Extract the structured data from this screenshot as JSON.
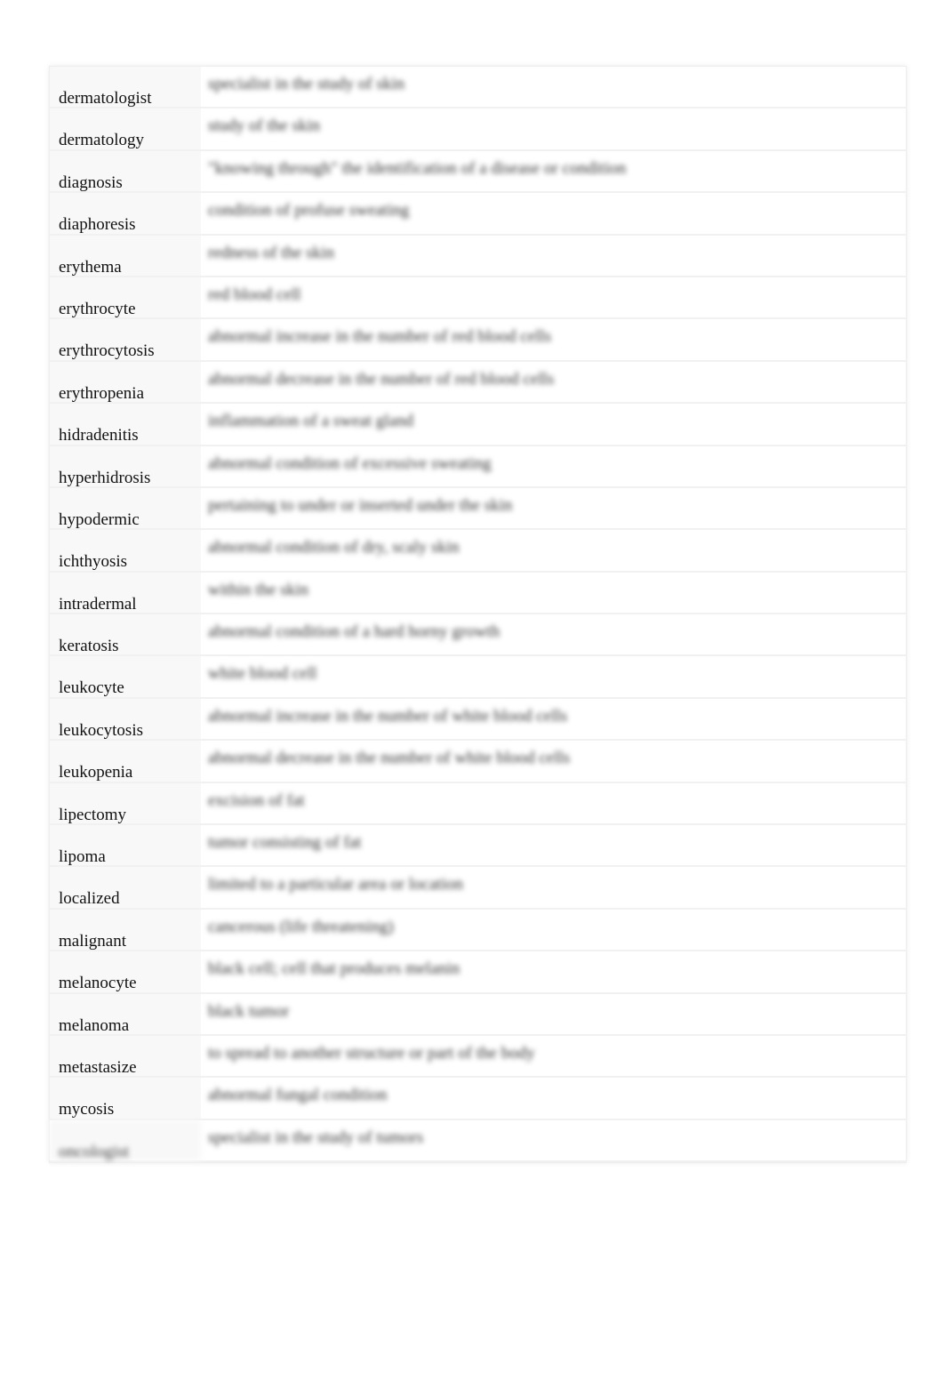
{
  "glossary": [
    {
      "term": "dermatologist",
      "definition": "specialist in the study of skin"
    },
    {
      "term": "dermatology",
      "definition": "study of the skin"
    },
    {
      "term": "diagnosis",
      "definition": "\"knowing through\" the identification of a disease or condition"
    },
    {
      "term": "diaphoresis",
      "definition": "condition of profuse sweating"
    },
    {
      "term": "erythema",
      "definition": "redness of the skin"
    },
    {
      "term": "erythrocyte",
      "definition": "red blood cell"
    },
    {
      "term": "erythrocytosis",
      "definition": "abnormal increase in the number of red blood cells"
    },
    {
      "term": "erythropenia",
      "definition": "abnormal decrease in the number of red blood cells"
    },
    {
      "term": "hidradenitis",
      "definition": "inflammation of a sweat gland"
    },
    {
      "term": "hyperhidrosis",
      "definition": "abnormal condition of excessive sweating"
    },
    {
      "term": "hypodermic",
      "definition": "pertaining to under or inserted under the skin"
    },
    {
      "term": "ichthyosis",
      "definition": "abnormal condition of dry, scaly skin"
    },
    {
      "term": "intradermal",
      "definition": "within the skin"
    },
    {
      "term": "keratosis",
      "definition": "abnormal condition of a hard horny growth"
    },
    {
      "term": "leukocyte",
      "definition": "white blood cell"
    },
    {
      "term": "leukocytosis",
      "definition": "abnormal increase in the number of white blood cells"
    },
    {
      "term": "leukopenia",
      "definition": "abnormal decrease in the number of white blood cells"
    },
    {
      "term": "lipectomy",
      "definition": "excision of fat"
    },
    {
      "term": "lipoma",
      "definition": "tumor consisting of fat"
    },
    {
      "term": "localized",
      "definition": "limited to a particular area or location"
    },
    {
      "term": "malignant",
      "definition": "cancerous (life threatening)"
    },
    {
      "term": "melanocyte",
      "definition": "black cell; cell that produces melanin"
    },
    {
      "term": "melanoma",
      "definition": "black tumor"
    },
    {
      "term": "metastasize",
      "definition": "to spread to another structure or part of the body"
    },
    {
      "term": "mycosis",
      "definition": "abnormal fungal condition"
    },
    {
      "term": "oncologist",
      "definition": "specialist in the study of tumors"
    }
  ]
}
